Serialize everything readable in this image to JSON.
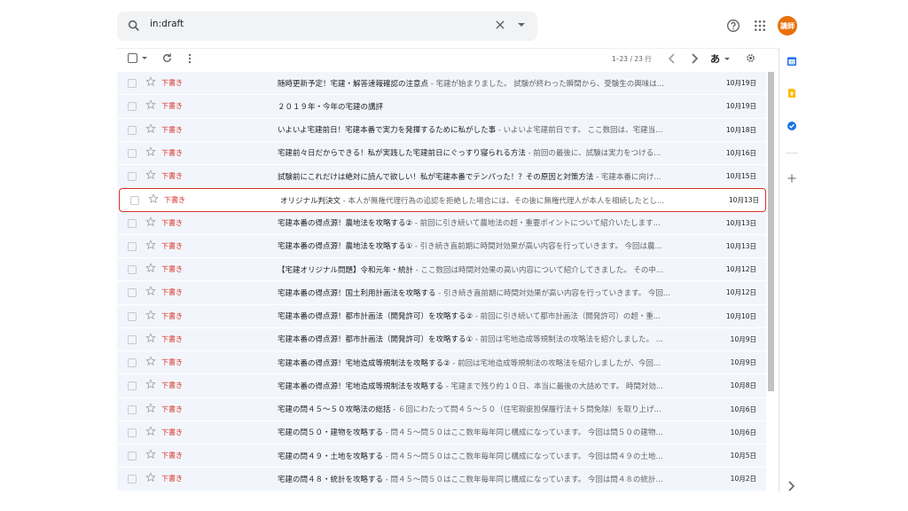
{
  "search": {
    "value": "in:draft"
  },
  "account": {
    "avatar_text": "講師"
  },
  "toolbar": {
    "page_count": "1–23 / 23 行",
    "input_tools": "あ"
  },
  "colors": {
    "draft_label": "#d93025",
    "avatar": "#e8710a",
    "row_bg": "#f2f6fc",
    "highlight_border": "#d93025"
  },
  "icons": [
    "search-icon",
    "close-icon",
    "chevron-down-icon",
    "help-icon",
    "apps-icon",
    "checkbox-icon",
    "refresh-icon",
    "more-vert-icon",
    "chevron-left-icon",
    "chevron-right-icon",
    "settings-icon",
    "star-icon",
    "calendar-icon",
    "keep-icon",
    "tasks-icon",
    "add-icon"
  ],
  "rows": [
    {
      "label": "下書き",
      "subject": "随時更新予定！宅建・解答速報確認の注意点",
      "snippet": " - 宅建が始まりました。 試験が終わった瞬間から、受験生の興味は...",
      "date": "10月19日"
    },
    {
      "label": "下書き",
      "subject": "２０１９年・今年の宅建の講評",
      "snippet": "",
      "date": "10月19日"
    },
    {
      "label": "下書き",
      "subject": "いよいよ宅建前日！宅建本番で実力を発揮するために私がした事",
      "snippet": " - いよいよ宅建前日です。 ここ数回は、宅建当...",
      "date": "10月18日"
    },
    {
      "label": "下書き",
      "subject": "宅建前々日だからできる！私が実践した宅建前日にぐっすり寝られる方法",
      "snippet": " - 前回の最後に、試験は実力をつける...",
      "date": "10月16日"
    },
    {
      "label": "下書き",
      "subject": "試験前にこれだけは絶対に読んで欲しい！私が宅建本番でテンパった！？その原因と対策方法",
      "snippet": " - 宅建本番に向け...",
      "date": "10月15日"
    },
    {
      "label": "下書き",
      "subject": "オリジナル判決文",
      "snippet": " - 本人が無権代理行為の追認を拒絶した場合には、その後に無権代理人が本人を相続したとし...",
      "date": "10月13日"
    },
    {
      "label": "下書き",
      "subject": "宅建本番の得点源！農地法を攻略する②",
      "snippet": " - 前回に引き続いて農地法の超・重要ポイントについて紹介いたします...",
      "date": "10月13日"
    },
    {
      "label": "下書き",
      "subject": "宅建本番の得点源！農地法を攻略する①",
      "snippet": " - 引き続き直前期に時間対効果が高い内容を行っていきます。 今回は農...",
      "date": "10月13日"
    },
    {
      "label": "下書き",
      "subject": "【宅建オリジナル問題】令和元年・統計",
      "snippet": " - ここ数回は時間対効果の高い内容について紹介してきました。 その中...",
      "date": "10月12日"
    },
    {
      "label": "下書き",
      "subject": "宅建本番の得点源！国土利用計画法を攻略する",
      "snippet": " - 引き続き直前期に時間対効果が高い内容を行っていきます。 今回...",
      "date": "10月12日"
    },
    {
      "label": "下書き",
      "subject": "宅建本番の得点源！都市計画法（開発許可）を攻略する②",
      "snippet": " - 前回に引き続いて都市計画法（開発許可）の超・重...",
      "date": "10月10日"
    },
    {
      "label": "下書き",
      "subject": "宅建本番の得点源！都市計画法（開発許可）を攻略する①",
      "snippet": " - 前回は宅地造成等規制法の攻略法を紹介しました。 ...",
      "date": "10月9日"
    },
    {
      "label": "下書き",
      "subject": "宅建本番の得点源！宅地造成等規制法を攻略する②",
      "snippet": " - 前回は宅地造成等規制法の攻略法を紹介しましたが、今回...",
      "date": "10月9日"
    },
    {
      "label": "下書き",
      "subject": "宅建本番の得点源！宅地造成等規制法を攻略する",
      "snippet": " - 宅建まで残り約１０日、本当に最後の大詰めです。 時間対効...",
      "date": "10月8日"
    },
    {
      "label": "下書き",
      "subject": "宅建の問４５～５０攻略法の総括",
      "snippet": " - ６回にわたって問４５～５０（住宅瑕疵担保履行法＋５問免除）を取り上げ...",
      "date": "10月6日"
    },
    {
      "label": "下書き",
      "subject": "宅建の問５０・建物を攻略する",
      "snippet": " - 問４５～問５０はここ数年毎年同じ構成になっています。 今回は問５０の建物...",
      "date": "10月6日"
    },
    {
      "label": "下書き",
      "subject": "宅建の問４９・土地を攻略する",
      "snippet": " - 問４５～問５０はここ数年毎年同じ構成になっています。 今回は問４９の土地...",
      "date": "10月5日"
    },
    {
      "label": "下書き",
      "subject": "宅建の問４８・統計を攻略する",
      "snippet": " - 問４５～問５０はここ数年毎年同じ構成になっています。 今回は問４８の統計...",
      "date": "10月2日"
    }
  ]
}
